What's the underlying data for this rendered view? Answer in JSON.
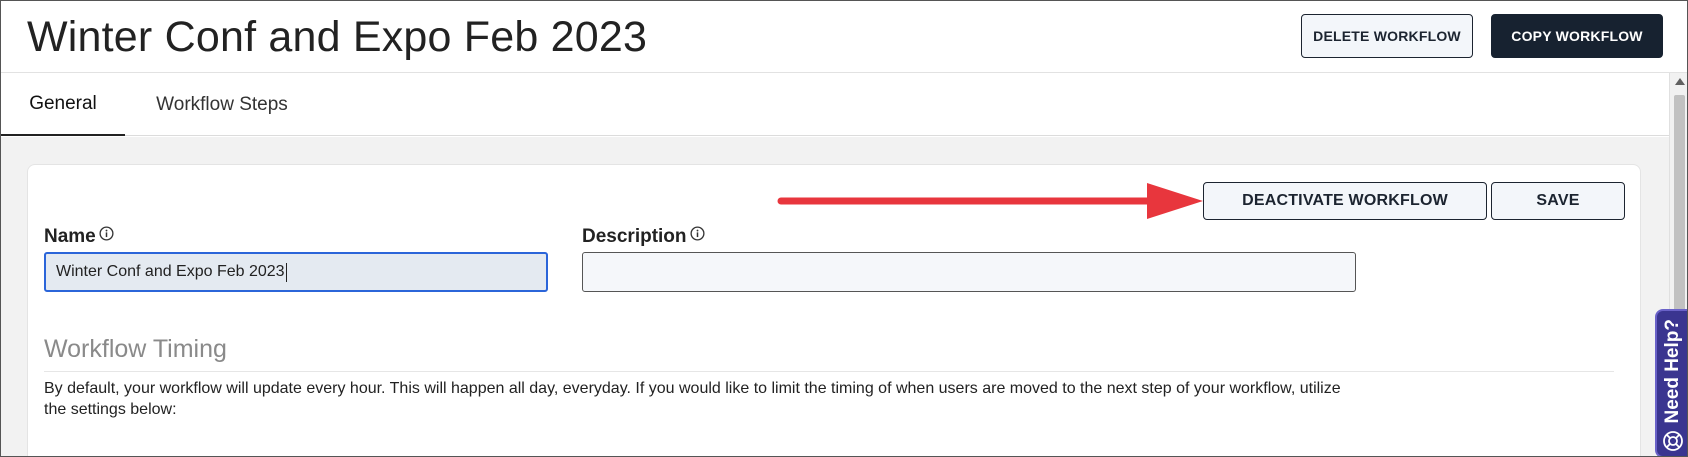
{
  "header": {
    "title": "Winter Conf and Expo Feb 2023",
    "delete_label": "DELETE WORKFLOW",
    "copy_label": "COPY WORKFLOW"
  },
  "tabs": [
    {
      "label": "General",
      "active": true
    },
    {
      "label": "Workflow Steps",
      "active": false
    }
  ],
  "form": {
    "deactivate_label": "DEACTIVATE WORKFLOW",
    "save_label": "SAVE",
    "name_label": "Name",
    "name_value": "Winter Conf and Expo Feb 2023",
    "description_label": "Description",
    "description_value": ""
  },
  "timing": {
    "title": "Workflow Timing",
    "text": "By default, your workflow will update every hour. This will happen all day, everyday. If you would like to limit the timing of when users are moved to the next step of your workflow, utilize the settings below:"
  },
  "help": {
    "label": "Need Help?"
  },
  "colors": {
    "primary_dark": "#172230",
    "input_focus": "#2b65d9",
    "help_tab": "#3a3590",
    "annotation_arrow": "#e8363d"
  },
  "icons": [
    "info-icon",
    "lifebuoy-icon",
    "scroll-up-icon"
  ]
}
